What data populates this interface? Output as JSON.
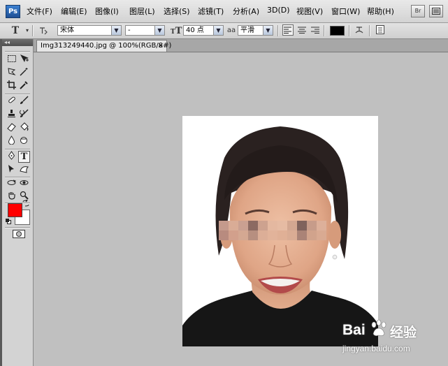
{
  "app": {
    "logo": "Ps"
  },
  "menu": [
    {
      "label": "文件(F)"
    },
    {
      "label": "编辑(E)"
    },
    {
      "label": "图像(I)"
    },
    {
      "label": "图层(L)"
    },
    {
      "label": "选择(S)"
    },
    {
      "label": "滤镜(T)"
    },
    {
      "label": "分析(A)"
    },
    {
      "label": "3D(D)"
    },
    {
      "label": "视图(V)"
    },
    {
      "label": "窗口(W)"
    },
    {
      "label": "帮助(H)"
    }
  ],
  "menubar_buttons": {
    "bridge": "Br"
  },
  "options": {
    "tool_glyph": "T",
    "font_family": "宋体",
    "font_style": "-",
    "font_size": "40 点",
    "antialias_label": "aa",
    "antialias": "平滑",
    "text_color": "#000000"
  },
  "document": {
    "tab_title": "Img313249440.jpg @ 100%(RGB/8#)",
    "close": "×"
  },
  "toolbar": {
    "foreground_color": "#ff0000",
    "background_color": "#ffffff",
    "collapse": "◂◂"
  },
  "watermark": {
    "brand_left": "Bai",
    "brand_right": "经验",
    "url": "jingyan.baidu.com"
  },
  "icons": [
    "marquee-icon",
    "move-icon",
    "lasso-icon",
    "magic-wand-icon",
    "crop-icon",
    "eyedropper-icon",
    "healing-brush-icon",
    "brush-icon",
    "clone-stamp-icon",
    "history-brush-icon",
    "eraser-icon",
    "paint-bucket-icon",
    "blur-icon",
    "dodge-icon",
    "pen-icon",
    "type-icon",
    "path-selection-icon",
    "shape-icon",
    "3d-rotate-icon",
    "3d-orbit-icon",
    "hand-icon",
    "zoom-icon",
    "swap-colors-icon",
    "default-colors-icon",
    "quick-mask-icon"
  ]
}
